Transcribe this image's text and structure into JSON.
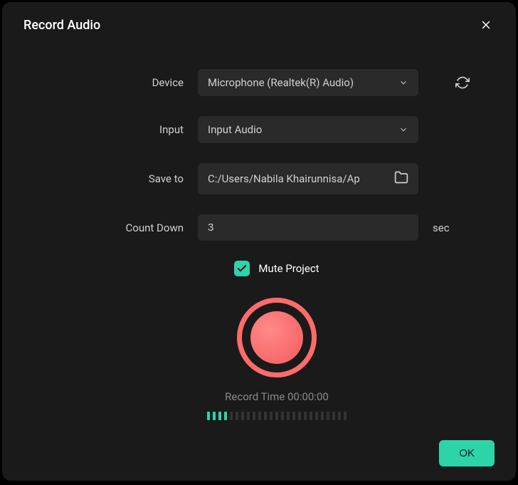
{
  "dialog": {
    "title": "Record Audio"
  },
  "form": {
    "device": {
      "label": "Device",
      "value": "Microphone (Realtek(R) Audio)"
    },
    "input": {
      "label": "Input",
      "value": "Input Audio"
    },
    "saveTo": {
      "label": "Save to",
      "value": "C:/Users/Nabila Khairunnisa/Ap"
    },
    "countDown": {
      "label": "Count Down",
      "value": "3",
      "unit": "sec"
    },
    "muteProject": {
      "label": "Mute Project",
      "checked": true
    }
  },
  "record": {
    "timeLabel": "Record Time 00:00:00",
    "levelMeter": {
      "activeBars": 4,
      "totalBars": 25
    }
  },
  "footer": {
    "okLabel": "OK"
  }
}
